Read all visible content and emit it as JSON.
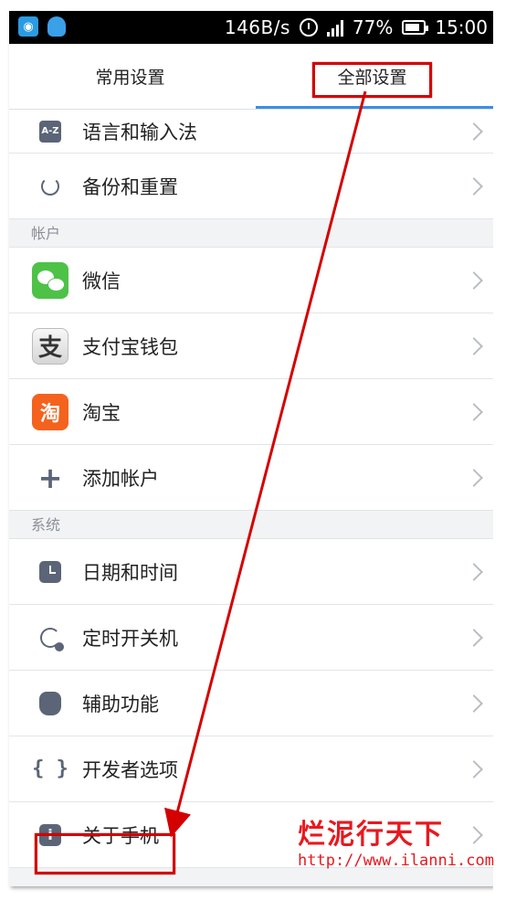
{
  "status_bar": {
    "net_speed": "146B/s",
    "battery": "77%",
    "time": "15:00"
  },
  "tabs": [
    {
      "label": "常用设置"
    },
    {
      "label": "全部设置"
    }
  ],
  "items": {
    "language": "语言和输入法",
    "backup": "备份和重置",
    "wechat": "微信",
    "alipay": "支付宝钱包",
    "taobao": "淘宝",
    "add_account": "添加帐户",
    "datetime": "日期和时间",
    "scheduled_power": "定时开关机",
    "accessibility": "辅助功能",
    "developer": "开发者选项",
    "about": "关于手机"
  },
  "sections": {
    "accounts": "帐户",
    "system": "系统"
  },
  "icon_glyphs": {
    "language": "A-Z",
    "alipay": "支",
    "taobao": "淘",
    "add_account": "+",
    "developer": "{ }",
    "about": "i"
  },
  "watermark": {
    "title": "烂泥行天下",
    "url": "http://www.ilanni.com"
  },
  "colors": {
    "accent": "#3a8ee6",
    "annotation_red": "#d40000",
    "wechat_green": "#4dc247",
    "taobao_orange": "#f4621e"
  }
}
